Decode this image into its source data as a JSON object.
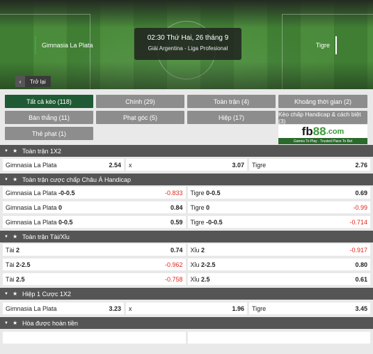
{
  "header": {
    "home_team": "Gimnasia La Plata",
    "away_team": "Tigre",
    "datetime": "02:30 Thứ Hai, 26 tháng 9",
    "league": "Giải Argentina - Liga Profesional",
    "back_label": "Trở lại"
  },
  "tabs": [
    {
      "label": "Tất cả kèo (118)",
      "active": true
    },
    {
      "label": "Chính (29)",
      "active": false
    },
    {
      "label": "Toàn trận (4)",
      "active": false
    },
    {
      "label": "Khoảng thời gian (2)",
      "active": false
    },
    {
      "label": "Bàn thắng (11)",
      "active": false
    },
    {
      "label": "Phạt góc (5)",
      "active": false
    },
    {
      "label": "Hiệp (17)",
      "active": false
    },
    {
      "label": "Kèo chấp Handicap & cách biệt (3)",
      "active": false
    },
    {
      "label": "Thẻ phạt (1)",
      "active": false
    }
  ],
  "ad": {
    "brand_fb": "fb",
    "brand_num": "88",
    "brand_dot": ".com",
    "tagline": "Games To Play  ·  Trusted Place To Bet"
  },
  "sections": {
    "s1": {
      "title": "Toàn trận 1X2",
      "r0": {
        "c0": {
          "name": "Gimnasia La Plata",
          "odd": "2.54"
        },
        "c1": {
          "name": "x",
          "odd": "3.07"
        },
        "c2": {
          "name": "Tigre",
          "odd": "2.76"
        }
      }
    },
    "s2": {
      "title": "Toàn trận cược chấp Châu Á Handicap",
      "r0": {
        "c0": {
          "name": "Gimnasia La Plata ",
          "hc": "-0-0.5",
          "odd": "-0.833"
        },
        "c1": {
          "name": "Tigre ",
          "hc": "0-0.5",
          "odd": "0.69"
        }
      },
      "r1": {
        "c0": {
          "name": "Gimnasia La Plata ",
          "hc": "0",
          "odd": "0.84"
        },
        "c1": {
          "name": "Tigre ",
          "hc": "0",
          "odd": "-0.99"
        }
      },
      "r2": {
        "c0": {
          "name": "Gimnasia La Plata ",
          "hc": "0-0.5",
          "odd": "0.59"
        },
        "c1": {
          "name": "Tigre ",
          "hc": "-0-0.5",
          "odd": "-0.714"
        }
      }
    },
    "s3": {
      "title": "Toàn trận Tài/Xỉu",
      "r0": {
        "c0": {
          "name": "Tài ",
          "hc": "2",
          "odd": "0.74"
        },
        "c1": {
          "name": "Xỉu ",
          "hc": "2",
          "odd": "-0.917"
        }
      },
      "r1": {
        "c0": {
          "name": "Tài ",
          "hc": "2-2.5",
          "odd": "-0.962"
        },
        "c1": {
          "name": "Xỉu ",
          "hc": "2-2.5",
          "odd": "0.80"
        }
      },
      "r2": {
        "c0": {
          "name": "Tài ",
          "hc": "2.5",
          "odd": "-0.758"
        },
        "c1": {
          "name": "Xỉu ",
          "hc": "2.5",
          "odd": "0.61"
        }
      }
    },
    "s4": {
      "title": "Hiệp 1 Cược 1X2",
      "r0": {
        "c0": {
          "name": "Gimnasia La Plata",
          "odd": "3.23"
        },
        "c1": {
          "name": "x",
          "odd": "1.96"
        },
        "c2": {
          "name": "Tigre",
          "odd": "3.45"
        }
      }
    },
    "s5": {
      "title": "Hòa được hoàn tiền"
    }
  },
  "colors": {
    "active_tab": "#1f5a34",
    "tab": "#8d8d8d",
    "section_header": "#555555",
    "negative_odd": "#e0261b"
  }
}
